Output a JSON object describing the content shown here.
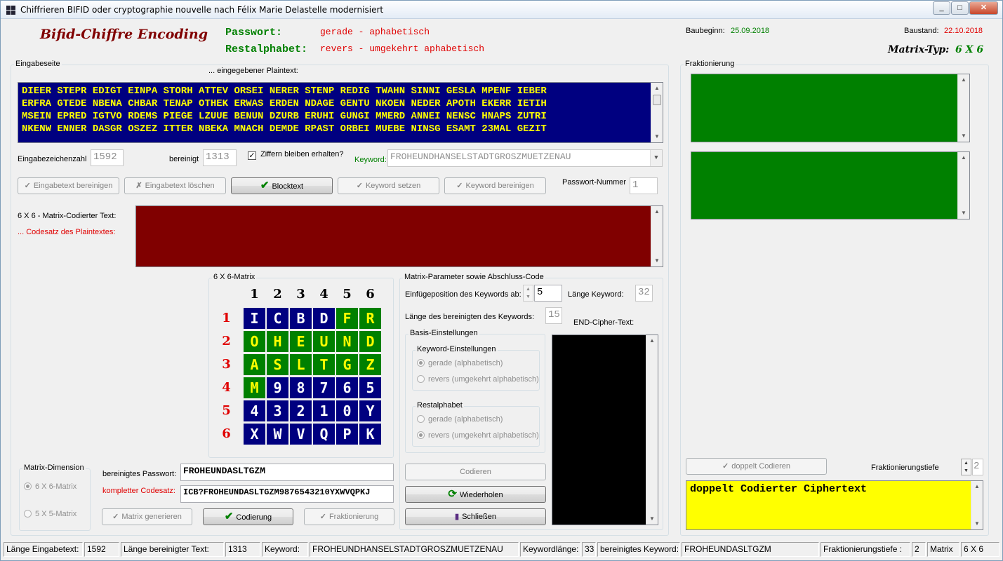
{
  "window": {
    "title": "Chiffrieren BIFID oder cryptographie nouvelle nach Félix Marie Delastelle modernisiert",
    "min": "_",
    "max": "□",
    "close": "✕"
  },
  "header": {
    "app_title": "Bifid-Chiffre Encoding",
    "passwort_label": "Passwort:",
    "passwort_value": "gerade - aphabetisch",
    "rest_label": "Restalphabet:",
    "rest_value": "revers - umgekehrt aphabetisch",
    "baubeginn_label": "Baubeginn:",
    "baubeginn_value": "25.09.2018",
    "baustand_label": "Baustand:",
    "baustand_value": "22.10.2018",
    "matrixtyp_label": "Matrix-Typ:",
    "matrixtyp_value": "6 X 6"
  },
  "input": {
    "group_label": "Eingabeseite",
    "plaintext_caption": "... eingegebener Plaintext:",
    "plaintext_lines": [
      "DIEER STEPR EDIGT EINPA STORH ATTEV ORSEI NERER STENP REDIG TWAHN SINNI GESLA MPENF IEBER",
      "ERFRA GTEDE NBENA CHBAR TENAP OTHEK ERWAS ERDEN NDAGE GENTU NKOEN NEDER APOTH EKERR IETIH",
      "MSEIN EPRED IGTVO RDEMS PIEGE LZUUE BENUN DZURB ERUHI GUNGI MMERD ANNEI NENSC HNAPS ZUTRI",
      "NKENW ENNER DASGR OSZEZ ITTER NBEKA MNACH DEMDE RPAST ORBEI MUEBE NINSG ESAMT 23MAL GEZIT"
    ],
    "count_label": "Eingabezeichenzahl",
    "count_value": "1592",
    "clean_label": "bereinigt",
    "clean_value": "1313",
    "digits_label": "Ziffern bleiben erhalten?",
    "keyword_label": "Keyword:",
    "keyword_value": "FROHEUNDHANSELSTADTGROSZMUETZENAU",
    "pwnum_label": "Passwort-Nummer",
    "pwnum_value": "1"
  },
  "buttons": {
    "clean_input": "Eingabetext bereinigen",
    "delete_input": "Eingabetext löschen",
    "blocktext": "Blocktext",
    "set_keyword": "Keyword setzen",
    "clean_keyword": "Keyword bereinigen",
    "gen_matrix": "Matrix generieren",
    "codierung": "Codierung",
    "fraktionierung": "Fraktionierung",
    "codieren": "Codieren",
    "wiederholen": "Wiederholen",
    "schliessen": "Schließen",
    "doppelt": "doppelt Codieren"
  },
  "coded": {
    "label1": "6 X 6 - Matrix-Codierter Text:",
    "label2": "... Codesatz des Plaintextes:"
  },
  "matrix": {
    "group_label": "6 X 6-Matrix",
    "col_headers": [
      "1",
      "2",
      "3",
      "4",
      "5",
      "6"
    ],
    "row_headers": [
      "1",
      "2",
      "3",
      "4",
      "5",
      "6"
    ],
    "rows": [
      [
        "I",
        "C",
        "B",
        "D",
        "F",
        "R"
      ],
      [
        "O",
        "H",
        "E",
        "U",
        "N",
        "D"
      ],
      [
        "A",
        "S",
        "L",
        "T",
        "G",
        "Z"
      ],
      [
        "M",
        "9",
        "8",
        "7",
        "6",
        "5"
      ],
      [
        "4",
        "3",
        "2",
        "1",
        "0",
        "Y"
      ],
      [
        "X",
        "W",
        "V",
        "Q",
        "P",
        "K"
      ]
    ],
    "keyword_cells": [
      [
        0,
        4
      ],
      [
        0,
        5
      ],
      [
        1,
        0
      ],
      [
        1,
        1
      ],
      [
        1,
        2
      ],
      [
        1,
        3
      ],
      [
        1,
        4
      ],
      [
        1,
        5
      ],
      [
        2,
        0
      ],
      [
        2,
        1
      ],
      [
        2,
        2
      ],
      [
        2,
        3
      ],
      [
        2,
        4
      ],
      [
        2,
        5
      ],
      [
        3,
        0
      ]
    ]
  },
  "dimension": {
    "group_label": "Matrix-Dimension",
    "opt1": "6 X 6-Matrix",
    "opt2": "5 X 5-Matrix"
  },
  "passwords": {
    "clean_pw_label": "bereinigtes Passwort:",
    "clean_pw_value": "FROHEUNDASLTGZM",
    "codesatz_label": "kompletter Codesatz:",
    "codesatz_value": "ICB?FROHEUNDASLTGZM9876543210YXWVQPKJ"
  },
  "params": {
    "group_label": "Matrix-Parameter  sowie Abschluss-Code",
    "insert_label": "Einfügeposition des Keywords ab:",
    "insert_value": "5",
    "kwlen_label": "Länge Keyword:",
    "kwlen_value": "32",
    "cleanlen_label": "Länge des bereinigten des Keywords:",
    "cleanlen_value": "15",
    "end_cipher_label": "END-Cipher-Text:",
    "basis_label": "Basis-Einstellungen",
    "kw_settings_label": "Keyword-Einstellungen",
    "kw_opt1": "gerade (alphabetisch)",
    "kw_opt2": "revers (umgekehrt alphabetisch)",
    "rest_settings_label": "Restalphabet",
    "rest_opt1": "gerade (alphabetisch)",
    "rest_opt2": "revers (umgekehrt alphabetisch)"
  },
  "fraction": {
    "group_label": "Fraktionierung",
    "depth_label": "Fraktionierungstiefe",
    "depth_value": "2",
    "double_text": "doppelt Codierter Ciphertext"
  },
  "status": {
    "len_in_label": "Länge Eingabetext:",
    "len_in": "1592",
    "len_clean_label": "Länge bereinigter Text:",
    "len_clean": "1313",
    "kw_label": "Keyword:",
    "kw": "FROHEUNDHANSELSTADTGROSZMUETZENAU",
    "kwlen_label": "Keywordlänge:",
    "kwlen": "33",
    "clean_kw_label": "bereinigtes Keyword:",
    "clean_kw": "FROHEUNDASLTGZM",
    "depth_label": "Fraktionierungstiefe :",
    "depth": "2",
    "matrix_label": "Matrix",
    "matrix": "6 X 6"
  },
  "colors": {
    "navy": "#000080",
    "green": "#008000",
    "dark_red": "#800000",
    "yellow": "#ffff00",
    "black": "#000000"
  }
}
